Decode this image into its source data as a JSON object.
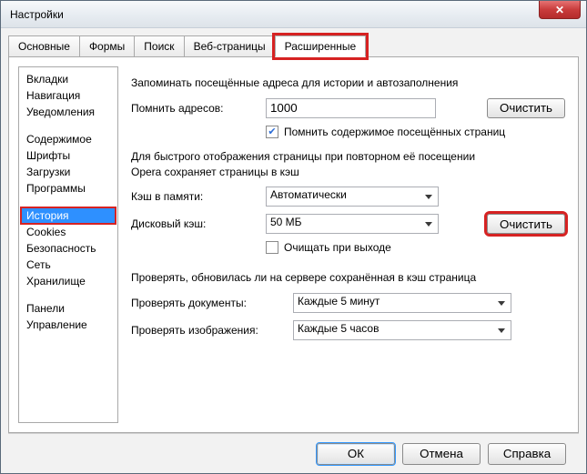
{
  "window": {
    "title": "Настройки"
  },
  "tabs": {
    "basic": "Основные",
    "forms": "Формы",
    "search": "Поиск",
    "webpages": "Веб-страницы",
    "advanced": "Расширенные"
  },
  "sidebar": {
    "g1": {
      "tabs_": "Вкладки",
      "navigation": "Навигация",
      "notifications": "Уведомления"
    },
    "g2": {
      "content": "Содержимое",
      "fonts": "Шрифты",
      "downloads": "Загрузки",
      "programs": "Программы"
    },
    "g3": {
      "history": "История",
      "cookies": "Cookies",
      "security": "Безопасность",
      "network": "Сеть",
      "storage": "Хранилище"
    },
    "g4": {
      "panels": "Панели",
      "management": "Управление"
    }
  },
  "history": {
    "remember_desc": "Запоминать посещённые адреса для истории и автозаполнения",
    "addresses_label": "Помнить адресов:",
    "addresses_value": "1000",
    "clear_btn": "Очистить",
    "remember_content_checked": true,
    "remember_content_label": "Помнить содержимое посещённых страниц",
    "cache_desc1": "Для быстрого отображения страницы при повторном её посещении",
    "cache_desc2": "Opera сохраняет страницы в кэш",
    "mem_cache_label": "Кэш в памяти:",
    "mem_cache_value": "Автоматически",
    "disk_cache_label": "Дисковый кэш:",
    "disk_cache_value": "50 МБ",
    "disk_clear_btn": "Очистить",
    "clear_on_exit_checked": false,
    "clear_on_exit_label": "Очищать при выходе",
    "server_desc": "Проверять, обновилась ли на сервере сохранённая в кэш страница",
    "check_docs_label": "Проверять документы:",
    "check_docs_value": "Каждые 5 минут",
    "check_imgs_label": "Проверять изображения:",
    "check_imgs_value": "Каждые 5 часов"
  },
  "footer": {
    "ok": "ОК",
    "cancel": "Отмена",
    "help": "Справка"
  }
}
